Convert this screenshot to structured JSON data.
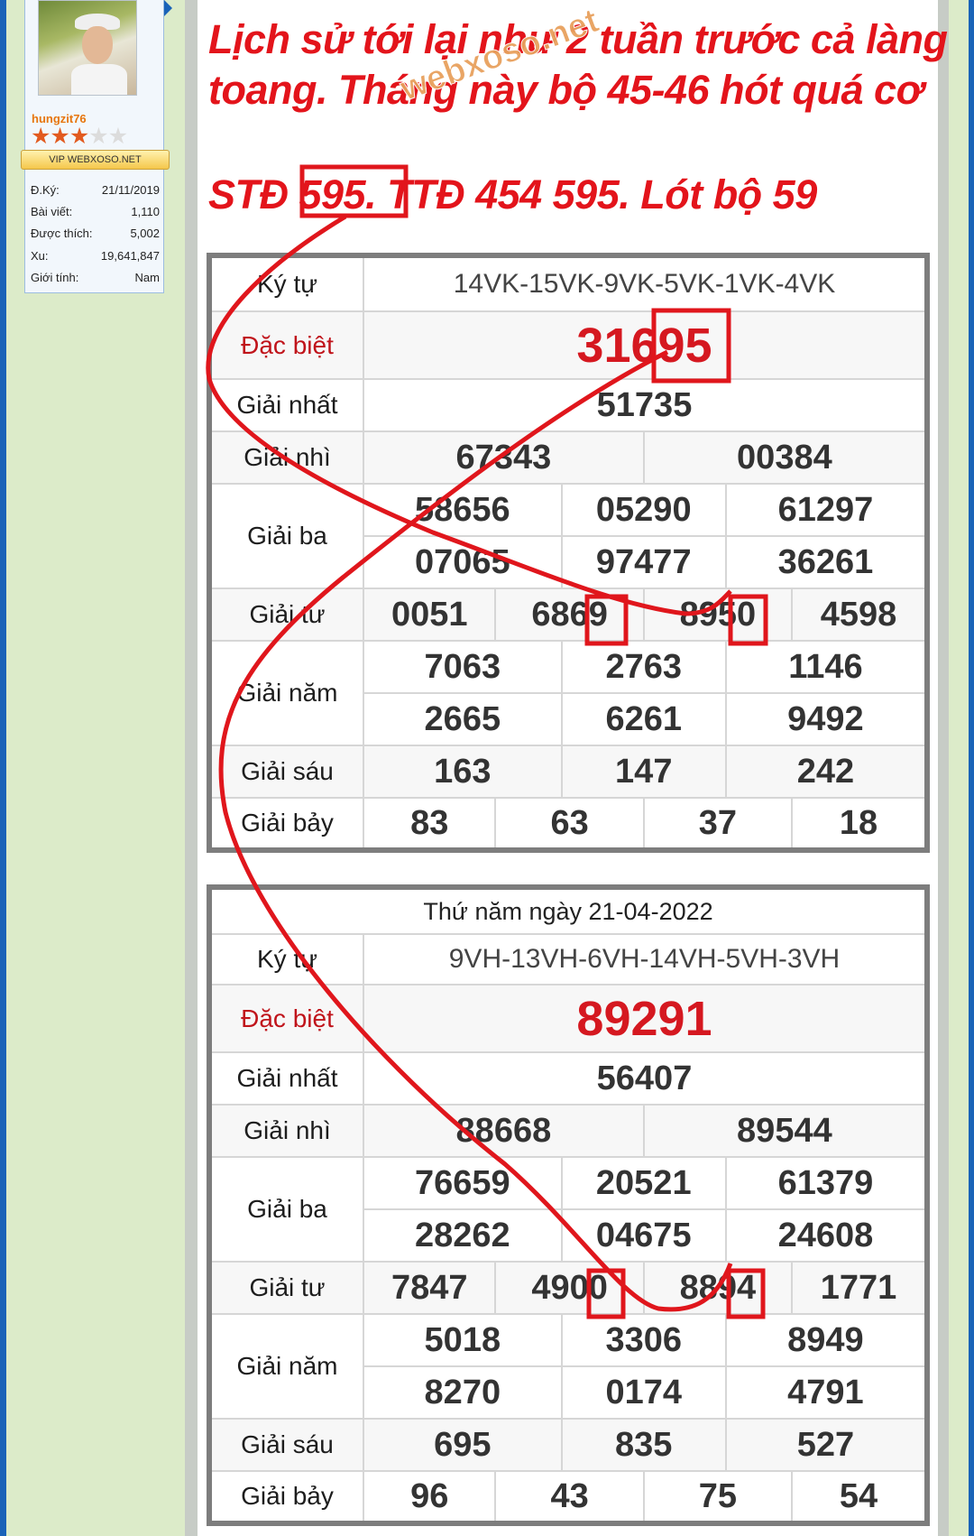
{
  "user": {
    "username": "hungzit76",
    "badge": "VIP WEBXOSO.NET",
    "stats": [
      {
        "label": "Đ.Ký:",
        "value": "21/11/2019"
      },
      {
        "label": "Bài viết:",
        "value": "1,110"
      },
      {
        "label": "Được thích:",
        "value": "5,002"
      },
      {
        "label": "Xu:",
        "value": "19,641,847"
      },
      {
        "label": "Giới tính:",
        "value": "Nam"
      }
    ],
    "rating_stars": 3,
    "rating_max": 5
  },
  "post": {
    "line1": "Lịch sử tới lại như 2 tuần trước cả làng",
    "line2": "toang. Tháng này bộ 45-46 hót quá cơ",
    "line3": "STĐ 595. TTĐ 454 595. Lót bộ 59",
    "watermark": "webxoso.net"
  },
  "table1": {
    "labels": {
      "kytu": "Ký tự",
      "db": "Đặc biệt",
      "g1": "Giải nhất",
      "g2": "Giải nhì",
      "g3": "Giải ba",
      "g4": "Giải tư",
      "g5": "Giải năm",
      "g6": "Giải sáu",
      "g7": "Giải bảy"
    },
    "kytu": "14VK-15VK-9VK-5VK-1VK-4VK",
    "db": "31695",
    "g1": "51735",
    "g2": [
      "67343",
      "00384"
    ],
    "g3": [
      "58656",
      "05290",
      "61297",
      "07065",
      "97477",
      "36261"
    ],
    "g4": [
      "0051",
      "6869",
      "8950",
      "4598"
    ],
    "g5": [
      "7063",
      "2763",
      "1146",
      "2665",
      "6261",
      "9492"
    ],
    "g6": [
      "163",
      "147",
      "242"
    ],
    "g7": [
      "83",
      "63",
      "37",
      "18"
    ]
  },
  "table2": {
    "date": "Thứ năm ngày 21-04-2022",
    "labels": {
      "kytu": "Ký tự",
      "db": "Đặc biệt",
      "g1": "Giải nhất",
      "g2": "Giải nhì",
      "g3": "Giải ba",
      "g4": "Giải tư",
      "g5": "Giải năm",
      "g6": "Giải sáu",
      "g7": "Giải bảy"
    },
    "kytu": "9VH-13VH-6VH-14VH-5VH-3VH",
    "db": "89291",
    "g1": "56407",
    "g2": [
      "88668",
      "89544"
    ],
    "g3": [
      "76659",
      "20521",
      "61379",
      "28262",
      "04675",
      "24608"
    ],
    "g4": [
      "7847",
      "4900",
      "8894",
      "1771"
    ],
    "g5": [
      "5018",
      "3306",
      "8949",
      "8270",
      "0174",
      "4791"
    ],
    "g6": [
      "695",
      "835",
      "527"
    ],
    "g7": [
      "96",
      "43",
      "75",
      "54"
    ]
  },
  "colors": {
    "accent_red": "#e3141b",
    "sidebar_blue": "#1a63b8",
    "page_green": "#dcebc9"
  }
}
